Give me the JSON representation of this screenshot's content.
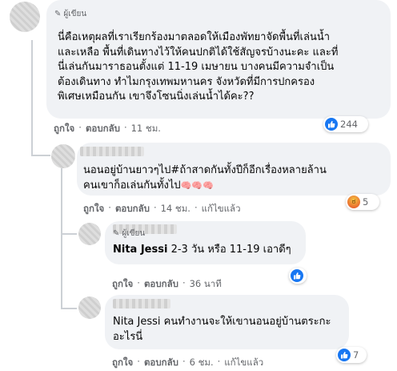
{
  "labels": {
    "edited": "ผู้เขียน",
    "like": "ถูกใจ",
    "reply": "ตอบกลับ",
    "edited_tag": "แก้ไขแล้ว"
  },
  "comments": [
    {
      "badge": "ผู้เขียน",
      "lines": [
        "นี่คือเหตุผลที่เราเรียกร้องมาตลอดให้เมืองพัทยาจัดพื้นที่เล่นน้ำ",
        "และเหลือ พื้นที่เดินทางไว้ให้คนปกติได้ใช้สัญจรบ้างนะคะ และที่",
        "นี่เล่นกันมาราธอนตั้งแต่ 11-19 เมษายน บางคนมีความจำเป็น",
        "ต้องเดินทาง ทำไมกรุงเทพมหานคร จังหวัดที่มีการปกครอง",
        "พิเศษเหมือนกัน เขาจึงโซนนิ่งเล่นน้ำได้คะ??"
      ],
      "time": "11 ชม.",
      "reaction_count": "244"
    },
    {
      "lines": [
        "นอนอยู่บ้านยาวๆไป#ถ้าสาดกันทั้งปีก็อีกเรื่องหลายล้าน",
        "คนเขาก็อเล่นกันทั้งไป"
      ],
      "emoji": "🧠🧠🧠",
      "time": "14 ชม.",
      "reaction_count": "5"
    },
    {
      "badge": "ผู้เขียน",
      "mention": "Nita Jessi",
      "text": "2-3 วัน หรือ 11-19 เอาดีๆ",
      "time": "36 นาที"
    },
    {
      "mention": "Nita Jessi",
      "line1": "คนทำงานจะให้เขานอนอยู่บ้านตระกะ",
      "line2": "อะไรนี่",
      "time": "6 ชม.",
      "reaction_count": "7"
    }
  ],
  "colors": {
    "bubble": "#f0f2f5",
    "like_blue": "#1877f2",
    "meta_gray": "#65676b",
    "thread_line": "#ccd0d5"
  }
}
